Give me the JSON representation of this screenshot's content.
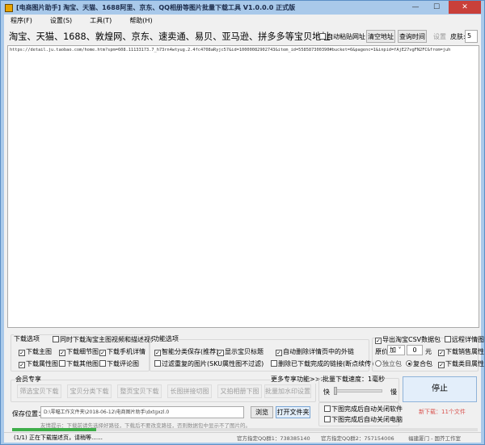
{
  "window": {
    "title": "[电商图片助手] 淘宝、天猫、1688阿里、京东、QQ相册等图片批量下载工具 V1.0.0.0 正式版"
  },
  "menu": [
    "程序(F)",
    "设置(S)",
    "工具(T)",
    "帮助(H)"
  ],
  "address": {
    "label": "淘宝、天猫、1688、敦煌网、京东、速卖通、易贝、亚马逊、拼多多等宝贝地址:",
    "auto_paste": "自动粘贴网址",
    "auto_paste_checked": false,
    "clear": "清空地址",
    "query_time": "查询时间",
    "settings": "设置",
    "skin_label": "皮肤:",
    "skin_value": "5"
  },
  "url_text": "https://detail.ju.taobao.com/home.htm?spm=608.11133173.7_h73rn4wtyug.2.4fc4708aRyjc57&id=10000082902743&item_id=558587300390#bucket=6&pagenc=1&inpid=fAjE27vgFN2FC&from=juh",
  "download_options": {
    "title": "下载选项",
    "sync_video": "同时下载淘宝主图视频和描述视频",
    "items": [
      {
        "label": "下载主图",
        "checked": true
      },
      {
        "label": "下载细节图",
        "checked": true
      },
      {
        "label": "下载手机详情",
        "checked": true
      },
      {
        "label": "下载属性图",
        "checked": true
      },
      {
        "label": "下载其他图",
        "checked": false
      },
      {
        "label": "下载评论图",
        "checked": false
      }
    ]
  },
  "function_options": {
    "title": "功能选项",
    "items": [
      {
        "label": "智能分类保存(推荐)",
        "checked": true
      },
      {
        "label": "显示宝贝标题",
        "checked": true
      },
      {
        "label": "自动删除详情页中的外链",
        "checked": true
      },
      {
        "label": "过滤重复的图片(SKU属性图不过滤)",
        "checked": false
      },
      {
        "label": "删除已下载完成的链接(断点续传)",
        "checked": false
      }
    ]
  },
  "csv": {
    "export": "导出淘宝CSV数据包",
    "export_checked": true,
    "remote_detail": "远程详情图",
    "remote_checked": false,
    "price_label": "原价",
    "price_op": "加",
    "price_value": "0",
    "unit": "元",
    "sales_attr": "下载销售属性",
    "category_attr": "下载类目属性",
    "standalone": "独立包",
    "composite": "复合包",
    "selected_pack": "复合包"
  },
  "member": {
    "title": "会员专享",
    "more": "更多专享功能>>>",
    "buttons": [
      "筛选宝贝下载",
      "宝贝分类下载",
      "整页宝贝下载",
      "长图拼接切图",
      "又拍相册下图",
      "批量加水印设置"
    ]
  },
  "speed": {
    "label": "批量下载速度：1毫秒",
    "fast": "快",
    "slow": "慢",
    "value_ms": 1
  },
  "after": {
    "close_app": "下图完成后自动关闭软件",
    "shutdown": "下图完成后自动关闭电脑"
  },
  "stop": {
    "label": "停止",
    "new_download": "新下载：11个文件"
  },
  "save": {
    "label": "保存位置：",
    "path": "D:\\零幅工作文件夹\\2018-06-12\\电商图片助手\\dxtgxzl.0",
    "browse": "浏览",
    "open_folder": "打开文件夹",
    "tip": "友情提示：下载前请先选择好路径，下载后不要改变路径，否则数据包中显示不了图片的。"
  },
  "progress": 0.18,
  "status": {
    "text": "(1/1) 正在下载描述页，请稍等……",
    "qq1": "官方指定QQ群1：738385140",
    "qq2": "官方指定QQ群2：757154006",
    "studio": "福建厦门 - 国芥工作室"
  },
  "colors": {
    "progress": "#3fae4a",
    "new_download": "#d9534f",
    "stop_bg": "#e3eefa"
  }
}
